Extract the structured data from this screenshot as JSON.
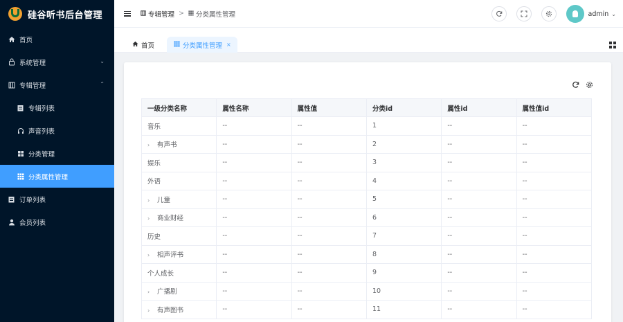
{
  "app": {
    "title": "硅谷听书后台管理"
  },
  "sidebar": {
    "items": [
      {
        "label": "首页",
        "icon": "home-icon"
      },
      {
        "label": "系统管理",
        "icon": "lock-icon"
      },
      {
        "label": "专辑管理",
        "icon": "album-icon"
      },
      {
        "label": "专辑列表",
        "icon": "list-icon"
      },
      {
        "label": "声音列表",
        "icon": "headphones-icon"
      },
      {
        "label": "分类管理",
        "icon": "grid-icon"
      },
      {
        "label": "分类属性管理",
        "icon": "grid-icon"
      },
      {
        "label": "订单列表",
        "icon": "clipboard-icon"
      },
      {
        "label": "会员列表",
        "icon": "user-icon"
      }
    ]
  },
  "header": {
    "breadcrumb": [
      "专辑管理",
      "分类属性管理"
    ],
    "username": "admin"
  },
  "tabs": [
    {
      "label": "首页",
      "icon": "home-icon"
    },
    {
      "label": "分类属性管理",
      "icon": "grid-icon"
    }
  ],
  "table": {
    "columns": [
      "一级分类名称",
      "属性名称",
      "属性值",
      "分类id",
      "属性id",
      "属性值id"
    ],
    "rows": [
      {
        "name": "音乐",
        "expandable": false,
        "attr_name": "--",
        "attr_value": "--",
        "category_id": "1",
        "attr_id": "--",
        "attr_value_id": "--"
      },
      {
        "name": "有声书",
        "expandable": true,
        "attr_name": "--",
        "attr_value": "--",
        "category_id": "2",
        "attr_id": "--",
        "attr_value_id": "--"
      },
      {
        "name": "娱乐",
        "expandable": false,
        "attr_name": "--",
        "attr_value": "--",
        "category_id": "3",
        "attr_id": "--",
        "attr_value_id": "--"
      },
      {
        "name": "外语",
        "expandable": false,
        "attr_name": "--",
        "attr_value": "--",
        "category_id": "4",
        "attr_id": "--",
        "attr_value_id": "--"
      },
      {
        "name": "儿童",
        "expandable": true,
        "attr_name": "--",
        "attr_value": "--",
        "category_id": "5",
        "attr_id": "--",
        "attr_value_id": "--"
      },
      {
        "name": "商业财经",
        "expandable": true,
        "attr_name": "--",
        "attr_value": "--",
        "category_id": "6",
        "attr_id": "--",
        "attr_value_id": "--"
      },
      {
        "name": "历史",
        "expandable": false,
        "attr_name": "--",
        "attr_value": "--",
        "category_id": "7",
        "attr_id": "--",
        "attr_value_id": "--"
      },
      {
        "name": "相声评书",
        "expandable": true,
        "attr_name": "--",
        "attr_value": "--",
        "category_id": "8",
        "attr_id": "--",
        "attr_value_id": "--"
      },
      {
        "name": "个人成长",
        "expandable": false,
        "attr_name": "--",
        "attr_value": "--",
        "category_id": "9",
        "attr_id": "--",
        "attr_value_id": "--"
      },
      {
        "name": "广播剧",
        "expandable": true,
        "attr_name": "--",
        "attr_value": "--",
        "category_id": "10",
        "attr_id": "--",
        "attr_value_id": "--"
      },
      {
        "name": "有声图书",
        "expandable": true,
        "attr_name": "--",
        "attr_value": "--",
        "category_id": "11",
        "attr_id": "--",
        "attr_value_id": "--"
      }
    ]
  },
  "colors": {
    "sidebar_bg": "#001529",
    "accent": "#409eff",
    "avatar_bg": "#5ec8c8"
  }
}
